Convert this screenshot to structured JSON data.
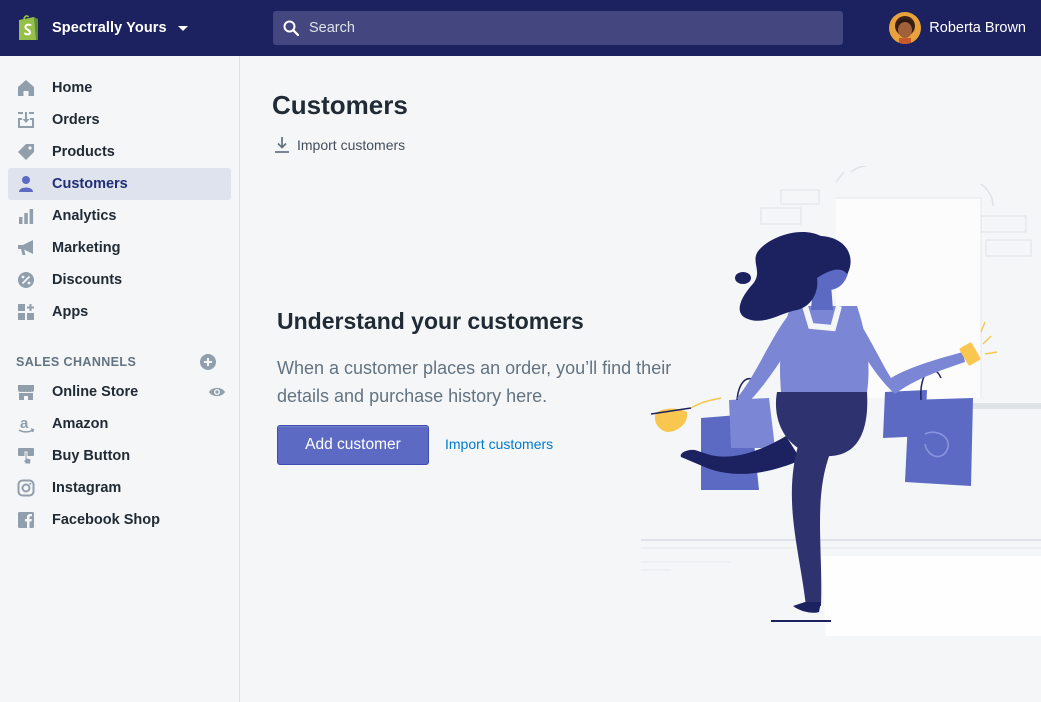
{
  "topbar": {
    "store_name": "Spectrally Yours",
    "search_placeholder": "Search",
    "user_name": "Roberta Brown"
  },
  "sidebar": {
    "items": [
      {
        "label": "Home",
        "icon": "home-icon"
      },
      {
        "label": "Orders",
        "icon": "orders-icon"
      },
      {
        "label": "Products",
        "icon": "tag-icon"
      },
      {
        "label": "Customers",
        "icon": "person-icon",
        "active": true
      },
      {
        "label": "Analytics",
        "icon": "bar-chart-icon"
      },
      {
        "label": "Marketing",
        "icon": "megaphone-icon"
      },
      {
        "label": "Discounts",
        "icon": "discount-icon"
      },
      {
        "label": "Apps",
        "icon": "apps-icon"
      }
    ],
    "sales_channels_label": "SALES CHANNELS",
    "channels": [
      {
        "label": "Online Store",
        "icon": "store-icon"
      },
      {
        "label": "Amazon",
        "icon": "amazon-icon"
      },
      {
        "label": "Buy Button",
        "icon": "buy-button-icon"
      },
      {
        "label": "Instagram",
        "icon": "instagram-icon"
      },
      {
        "label": "Facebook Shop",
        "icon": "facebook-icon"
      }
    ]
  },
  "main": {
    "title": "Customers",
    "import_label": "Import customers",
    "empty_state": {
      "heading": "Understand your customers",
      "body": "When a customer places an order, you’ll find their details and purchase history here.",
      "primary_button": "Add customer",
      "secondary_link": "Import customers"
    }
  },
  "colors": {
    "topbar": "#1c2260",
    "search": "#43467f",
    "accent": "#5c6ac4",
    "link": "#007ace",
    "active_nav_bg": "#dfe3ee",
    "illustration_purple": "#5c6ac4",
    "illustration_navy": "#1c2260"
  }
}
